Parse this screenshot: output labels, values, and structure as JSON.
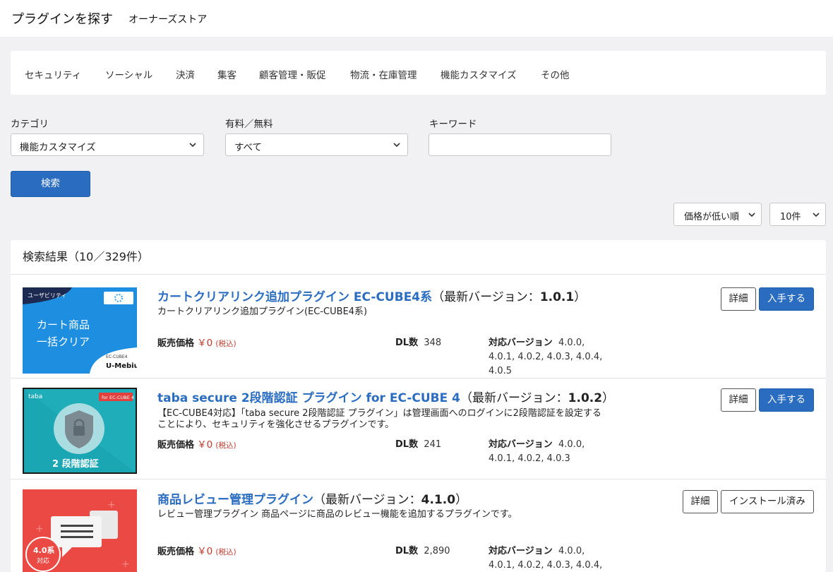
{
  "header": {
    "title": "プラグインを探す",
    "subtitle": "オーナーズストア"
  },
  "categories": [
    "セキュリティ",
    "ソーシャル",
    "決済",
    "集客",
    "顧客管理・販促",
    "物流・在庫管理",
    "機能カスタマイズ",
    "その他"
  ],
  "filters": {
    "category_label": "カテゴリ",
    "category_value": "機能カスタマイズ",
    "price_label": "有料／無料",
    "price_value": "すべて",
    "keyword_label": "キーワード",
    "keyword_value": ""
  },
  "search_button": "検索",
  "sort": {
    "order": "価格が低い順",
    "per_page": "10件"
  },
  "results": {
    "heading": "検索結果（10／329件）",
    "labels": {
      "price": "販売価格",
      "tax": "(税込)",
      "dl": "DL数",
      "compat": "対応バージョン",
      "latest_prefix": "（最新バージョン：",
      "latest_suffix": "）",
      "detail": "詳細",
      "get": "入手する",
      "installed": "インストール済み"
    },
    "items": [
      {
        "name": "カートクリアリンク追加プラグイン EC-CUBE4系",
        "version": "1.0.1",
        "description": "カートクリアリンク追加プラグイン(EC-CUBE4系)",
        "price": "￥0",
        "downloads": "348",
        "compat_line1": "4.0.0,",
        "compat_line2": "4.0.1, 4.0.2, 4.0.3, 4.0.4,",
        "compat_line3": "4.0.5",
        "thumb": {
          "tag": "ユーザビリティ",
          "line1": "カート商品",
          "line2": "一括クリア",
          "badge_top": "EC-CUBE4",
          "badge_bottom": "U-Mebius"
        }
      },
      {
        "name": "taba secure 2段階認証 プラグイン for EC-CUBE 4",
        "version": "1.0.2",
        "description": "【EC-CUBE4対応】「taba secure 2段階認証 プラグイン」は管理画面へのログインに2段階認証を設定することにより、セキュリティを強化させるプラグインです。",
        "price": "￥0",
        "downloads": "241",
        "compat_line1": "4.0.0,",
        "compat_line2": "4.0.1, 4.0.2, 4.0.3",
        "compat_line3": "",
        "thumb": {
          "brand": "taba",
          "badge": "for EC-CUBE 4",
          "caption": "2 段階認証"
        }
      },
      {
        "name": "商品レビュー管理プラグイン",
        "version": "4.1.0",
        "description": "レビュー管理プラグイン 商品ページに商品のレビュー機能を追加するプラグインです。",
        "price": "￥0",
        "downloads": "2,890",
        "compat_line1": "4.0.0,",
        "compat_line2": "4.0.1, 4.0.2, 4.0.3, 4.0.4,",
        "compat_line3": "",
        "thumb": {
          "badge_top": "4.0系",
          "badge_bottom": "対応"
        }
      }
    ]
  },
  "colors": {
    "link": "#2a6dc0",
    "price": "#c0392b",
    "background": "#f1f1f3"
  }
}
